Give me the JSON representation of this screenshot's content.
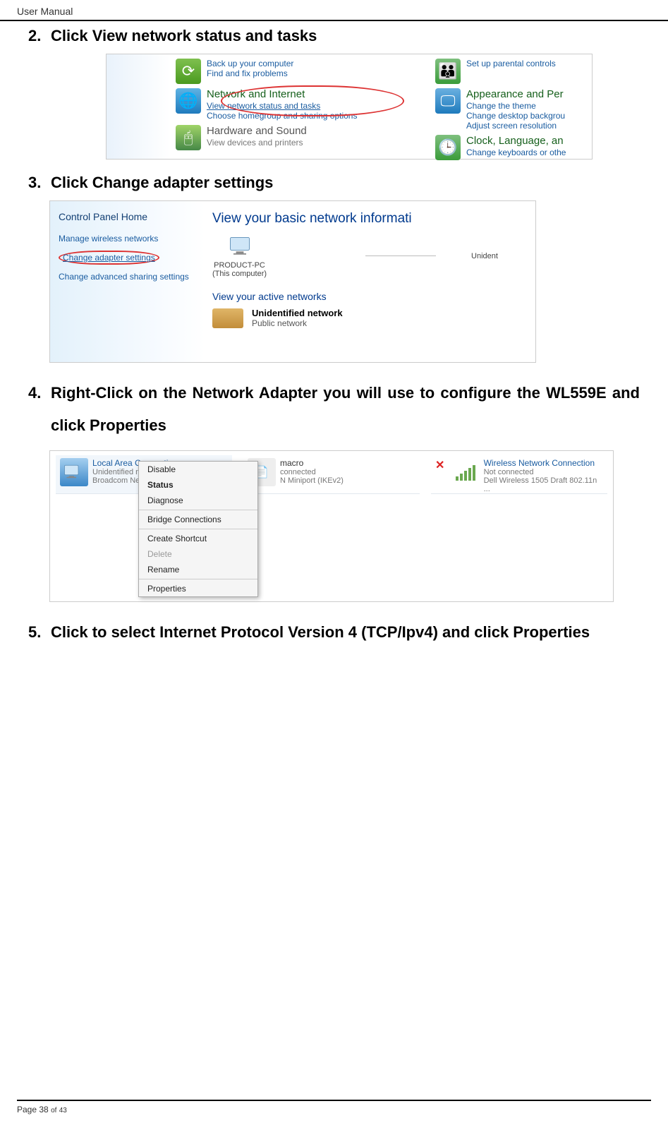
{
  "header": {
    "title": "User Manual"
  },
  "steps": {
    "s2": {
      "num": "2.",
      "title": "Click View network status and tasks"
    },
    "s3": {
      "num": "3.",
      "title": "Click Change adapter settings"
    },
    "s4": {
      "num": "4.",
      "title": "Right-Click on the Network Adapter you will use to configure the WL559E and click Properties"
    },
    "s5": {
      "num": "5.",
      "title": "Click to select Internet Protocol Version 4 (TCP/Ipv4) and click Properties"
    }
  },
  "fig1": {
    "backup": {
      "l1": "Back up your computer",
      "l2": "Find and fix problems"
    },
    "net": {
      "hed": "Network and Internet",
      "s1": "View network status and tasks",
      "s2": "Choose homegroup and sharing options"
    },
    "hw": {
      "hed": "Hardware and Sound",
      "s1": "View devices and printers"
    },
    "parent": {
      "l1": "Set up parental controls"
    },
    "appear": {
      "hed": "Appearance and Per",
      "s1": "Change the theme",
      "s2": "Change desktop backgrou",
      "s3": "Adjust screen resolution"
    },
    "clock": {
      "hed": "Clock, Language, an",
      "s1": "Change keyboards or othe"
    }
  },
  "fig2": {
    "sb_title": "Control Panel Home",
    "sb_l1": "Manage wireless networks",
    "sb_l2": "Change adapter settings",
    "sb_l3": "Change advanced sharing settings",
    "main_head": "View your basic network informati",
    "pc_name": "PRODUCT-PC",
    "pc_sub": "(This computer)",
    "unid": "Unident",
    "active": "View your active networks",
    "bench_t": "Unidentified network",
    "bench_s": "Public network"
  },
  "fig3": {
    "c1": {
      "t1": "Local Area Connection",
      "t2": "Unidentified ne",
      "t3": "Broadcom Net"
    },
    "c2": {
      "t1": "macro",
      "t2": "connected",
      "t3": "N Miniport (IKEv2)"
    },
    "c3": {
      "t1": "Wireless Network Connection",
      "t2": "Not connected",
      "t3": "Dell Wireless 1505 Draft 802.11n ..."
    }
  },
  "menu": {
    "m1": "Disable",
    "m2": "Status",
    "m3": "Diagnose",
    "m4": "Bridge Connections",
    "m5": "Create Shortcut",
    "m6": "Delete",
    "m7": "Rename",
    "m8": "Properties"
  },
  "footer": {
    "page": "Page 38",
    "of": "of",
    "total": "43"
  }
}
